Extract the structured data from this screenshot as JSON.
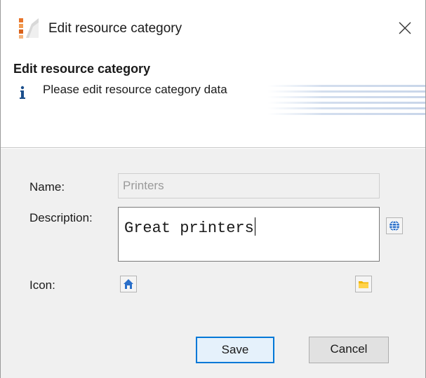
{
  "window": {
    "title": "Edit resource category",
    "icon": "resource-category-icon",
    "close_icon": "close-icon"
  },
  "header": {
    "title": "Edit resource category",
    "info_icon": "info-icon",
    "message": "Please edit resource category data"
  },
  "form": {
    "name_label": "Name:",
    "name_value": "Printers",
    "description_label": "Description:",
    "description_value": "Great printers",
    "icon_label": "Icon:",
    "globe_icon": "globe-icon",
    "selected_icon": "home-icon",
    "folder_icon": "folder-icon"
  },
  "buttons": {
    "save": "Save",
    "cancel": "Cancel"
  },
  "colors": {
    "accent": "#0078d7",
    "body_bg": "#f0f0f0"
  }
}
